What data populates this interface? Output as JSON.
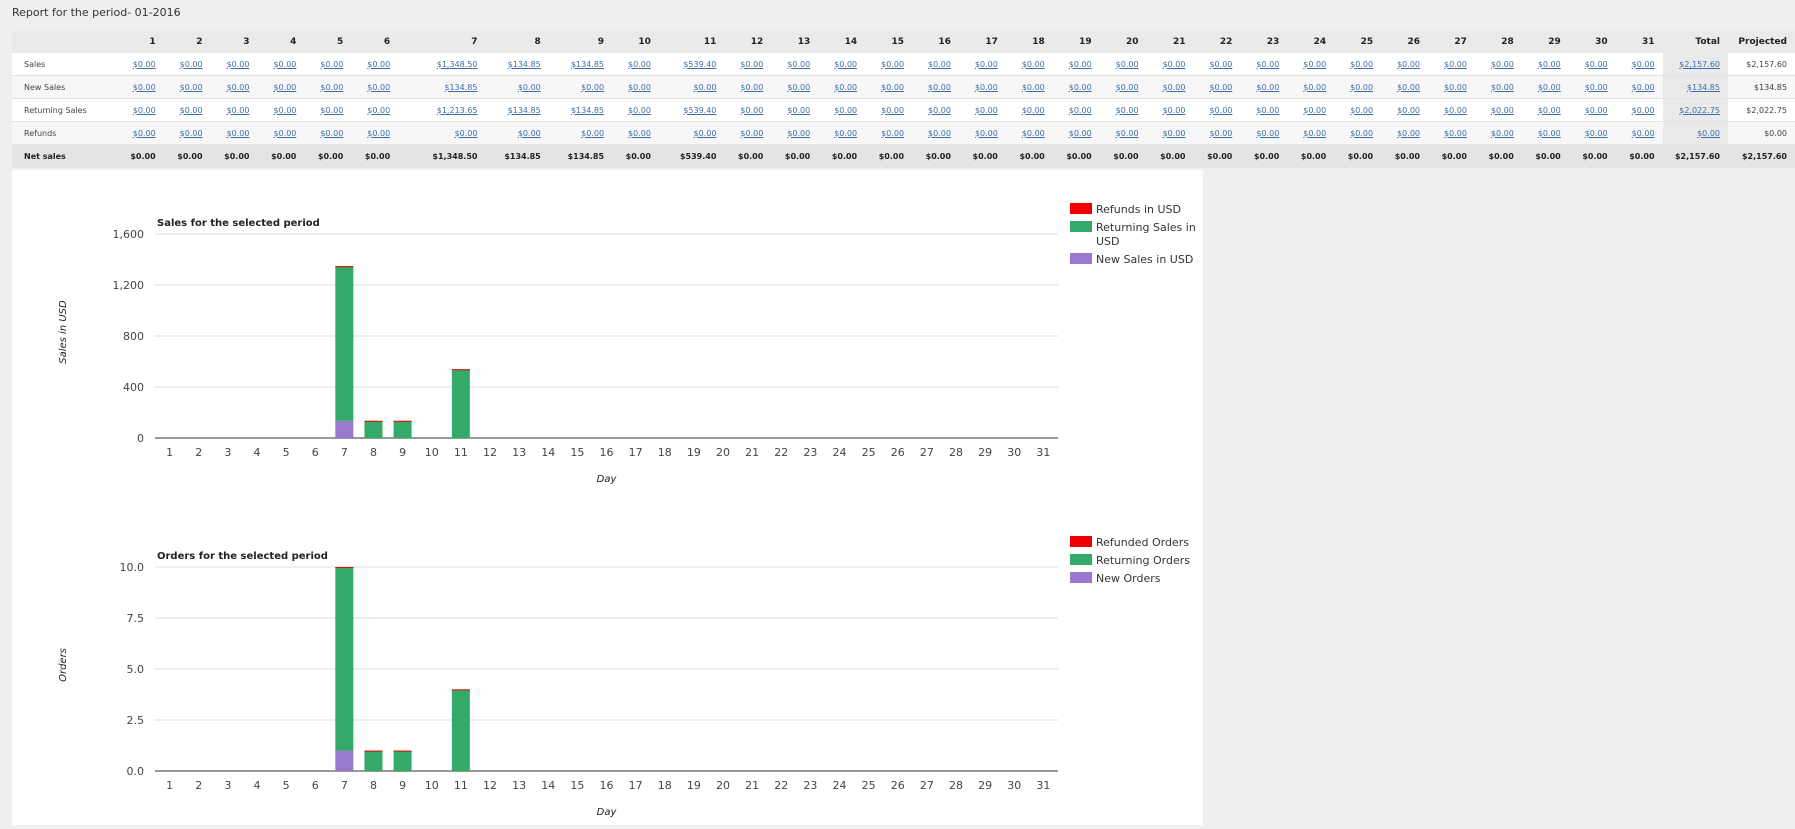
{
  "page": {
    "title": "Report for the period- 01-2016"
  },
  "table": {
    "days": [
      "1",
      "2",
      "3",
      "4",
      "5",
      "6",
      "7",
      "8",
      "9",
      "10",
      "11",
      "12",
      "13",
      "14",
      "15",
      "16",
      "17",
      "18",
      "19",
      "20",
      "21",
      "22",
      "23",
      "24",
      "25",
      "26",
      "27",
      "28",
      "29",
      "30",
      "31"
    ],
    "total_label": "Total",
    "projected_label": "Projected",
    "rows": [
      {
        "label": "Sales",
        "values": [
          "$0.00",
          "$0.00",
          "$0.00",
          "$0.00",
          "$0.00",
          "$0.00",
          "$1,348.50",
          "$134.85",
          "$134.85",
          "$0.00",
          "$539.40",
          "$0.00",
          "$0.00",
          "$0.00",
          "$0.00",
          "$0.00",
          "$0.00",
          "$0.00",
          "$0.00",
          "$0.00",
          "$0.00",
          "$0.00",
          "$0.00",
          "$0.00",
          "$0.00",
          "$0.00",
          "$0.00",
          "$0.00",
          "$0.00",
          "$0.00",
          "$0.00"
        ],
        "total": "$2,157.60",
        "projected": "$2,157.60"
      },
      {
        "label": "New Sales",
        "values": [
          "$0.00",
          "$0.00",
          "$0.00",
          "$0.00",
          "$0.00",
          "$0.00",
          "$134.85",
          "$0.00",
          "$0.00",
          "$0.00",
          "$0.00",
          "$0.00",
          "$0.00",
          "$0.00",
          "$0.00",
          "$0.00",
          "$0.00",
          "$0.00",
          "$0.00",
          "$0.00",
          "$0.00",
          "$0.00",
          "$0.00",
          "$0.00",
          "$0.00",
          "$0.00",
          "$0.00",
          "$0.00",
          "$0.00",
          "$0.00",
          "$0.00"
        ],
        "total": "$134.85",
        "projected": "$134.85"
      },
      {
        "label": "Returning Sales",
        "values": [
          "$0.00",
          "$0.00",
          "$0.00",
          "$0.00",
          "$0.00",
          "$0.00",
          "$1,213.65",
          "$134.85",
          "$134.85",
          "$0.00",
          "$539.40",
          "$0.00",
          "$0.00",
          "$0.00",
          "$0.00",
          "$0.00",
          "$0.00",
          "$0.00",
          "$0.00",
          "$0.00",
          "$0.00",
          "$0.00",
          "$0.00",
          "$0.00",
          "$0.00",
          "$0.00",
          "$0.00",
          "$0.00",
          "$0.00",
          "$0.00",
          "$0.00"
        ],
        "total": "$2,022.75",
        "projected": "$2,022.75"
      },
      {
        "label": "Refunds",
        "values": [
          "$0.00",
          "$0.00",
          "$0.00",
          "$0.00",
          "$0.00",
          "$0.00",
          "$0.00",
          "$0.00",
          "$0.00",
          "$0.00",
          "$0.00",
          "$0.00",
          "$0.00",
          "$0.00",
          "$0.00",
          "$0.00",
          "$0.00",
          "$0.00",
          "$0.00",
          "$0.00",
          "$0.00",
          "$0.00",
          "$0.00",
          "$0.00",
          "$0.00",
          "$0.00",
          "$0.00",
          "$0.00",
          "$0.00",
          "$0.00",
          "$0.00"
        ],
        "total": "$0.00",
        "projected": "$0.00"
      }
    ],
    "net": {
      "label": "Net sales",
      "values": [
        "$0.00",
        "$0.00",
        "$0.00",
        "$0.00",
        "$0.00",
        "$0.00",
        "$1,348.50",
        "$134.85",
        "$134.85",
        "$0.00",
        "$539.40",
        "$0.00",
        "$0.00",
        "$0.00",
        "$0.00",
        "$0.00",
        "$0.00",
        "$0.00",
        "$0.00",
        "$0.00",
        "$0.00",
        "$0.00",
        "$0.00",
        "$0.00",
        "$0.00",
        "$0.00",
        "$0.00",
        "$0.00",
        "$0.00",
        "$0.00",
        "$0.00"
      ],
      "total": "$2,157.60",
      "projected": "$2,157.60"
    }
  },
  "colors": {
    "refunds": "#ee0000",
    "returning": "#33aa6a",
    "new": "#9a78cf",
    "link": "#3f6fa8"
  },
  "chart_data": [
    {
      "type": "bar",
      "stacked": true,
      "title": "Sales for the selected period",
      "xlabel": "Day",
      "ylabel": "Sales in USD",
      "ylim": [
        0,
        1600
      ],
      "yticks": [
        "0",
        "400",
        "800",
        "1,200",
        "1,600"
      ],
      "ytick_values": [
        0,
        400,
        800,
        1200,
        1600
      ],
      "categories": [
        "1",
        "2",
        "3",
        "4",
        "5",
        "6",
        "7",
        "8",
        "9",
        "10",
        "11",
        "12",
        "13",
        "14",
        "15",
        "16",
        "17",
        "18",
        "19",
        "20",
        "21",
        "22",
        "23",
        "24",
        "25",
        "26",
        "27",
        "28",
        "29",
        "30",
        "31"
      ],
      "legend_position": "right",
      "series": [
        {
          "name": "New Sales in USD",
          "color": "#9a78cf",
          "values": [
            0,
            0,
            0,
            0,
            0,
            0,
            134.85,
            0,
            0,
            0,
            0,
            0,
            0,
            0,
            0,
            0,
            0,
            0,
            0,
            0,
            0,
            0,
            0,
            0,
            0,
            0,
            0,
            0,
            0,
            0,
            0
          ]
        },
        {
          "name": "Returning Sales in USD",
          "color": "#33aa6a",
          "values": [
            0,
            0,
            0,
            0,
            0,
            0,
            1213.65,
            134.85,
            134.85,
            0,
            539.4,
            0,
            0,
            0,
            0,
            0,
            0,
            0,
            0,
            0,
            0,
            0,
            0,
            0,
            0,
            0,
            0,
            0,
            0,
            0,
            0
          ]
        },
        {
          "name": "Refunds in USD",
          "color": "#ee0000",
          "values": [
            0,
            0,
            0,
            0,
            0,
            0,
            0,
            0,
            0,
            0,
            0,
            0,
            0,
            0,
            0,
            0,
            0,
            0,
            0,
            0,
            0,
            0,
            0,
            0,
            0,
            0,
            0,
            0,
            0,
            0,
            0
          ]
        }
      ],
      "legend_order": [
        "Refunds in USD",
        "Returning Sales in USD",
        "New Sales in USD"
      ]
    },
    {
      "type": "bar",
      "stacked": true,
      "title": "Orders for the selected period",
      "xlabel": "Day",
      "ylabel": "Orders",
      "ylim": [
        0,
        10
      ],
      "yticks": [
        "0.0",
        "2.5",
        "5.0",
        "7.5",
        "10.0"
      ],
      "ytick_values": [
        0,
        2.5,
        5,
        7.5,
        10
      ],
      "categories": [
        "1",
        "2",
        "3",
        "4",
        "5",
        "6",
        "7",
        "8",
        "9",
        "10",
        "11",
        "12",
        "13",
        "14",
        "15",
        "16",
        "17",
        "18",
        "19",
        "20",
        "21",
        "22",
        "23",
        "24",
        "25",
        "26",
        "27",
        "28",
        "29",
        "30",
        "31"
      ],
      "legend_position": "right",
      "series": [
        {
          "name": "New Orders",
          "color": "#9a78cf",
          "values": [
            0,
            0,
            0,
            0,
            0,
            0,
            1,
            0,
            0,
            0,
            0,
            0,
            0,
            0,
            0,
            0,
            0,
            0,
            0,
            0,
            0,
            0,
            0,
            0,
            0,
            0,
            0,
            0,
            0,
            0,
            0
          ]
        },
        {
          "name": "Returning Orders",
          "color": "#33aa6a",
          "values": [
            0,
            0,
            0,
            0,
            0,
            0,
            9,
            1,
            1,
            0,
            4,
            0,
            0,
            0,
            0,
            0,
            0,
            0,
            0,
            0,
            0,
            0,
            0,
            0,
            0,
            0,
            0,
            0,
            0,
            0,
            0
          ]
        },
        {
          "name": "Refunded Orders",
          "color": "#ee0000",
          "values": [
            0,
            0,
            0,
            0,
            0,
            0,
            0,
            0,
            0,
            0,
            0,
            0,
            0,
            0,
            0,
            0,
            0,
            0,
            0,
            0,
            0,
            0,
            0,
            0,
            0,
            0,
            0,
            0,
            0,
            0,
            0
          ]
        }
      ],
      "legend_order": [
        "Refunded Orders",
        "Returning Orders",
        "New Orders"
      ]
    }
  ]
}
